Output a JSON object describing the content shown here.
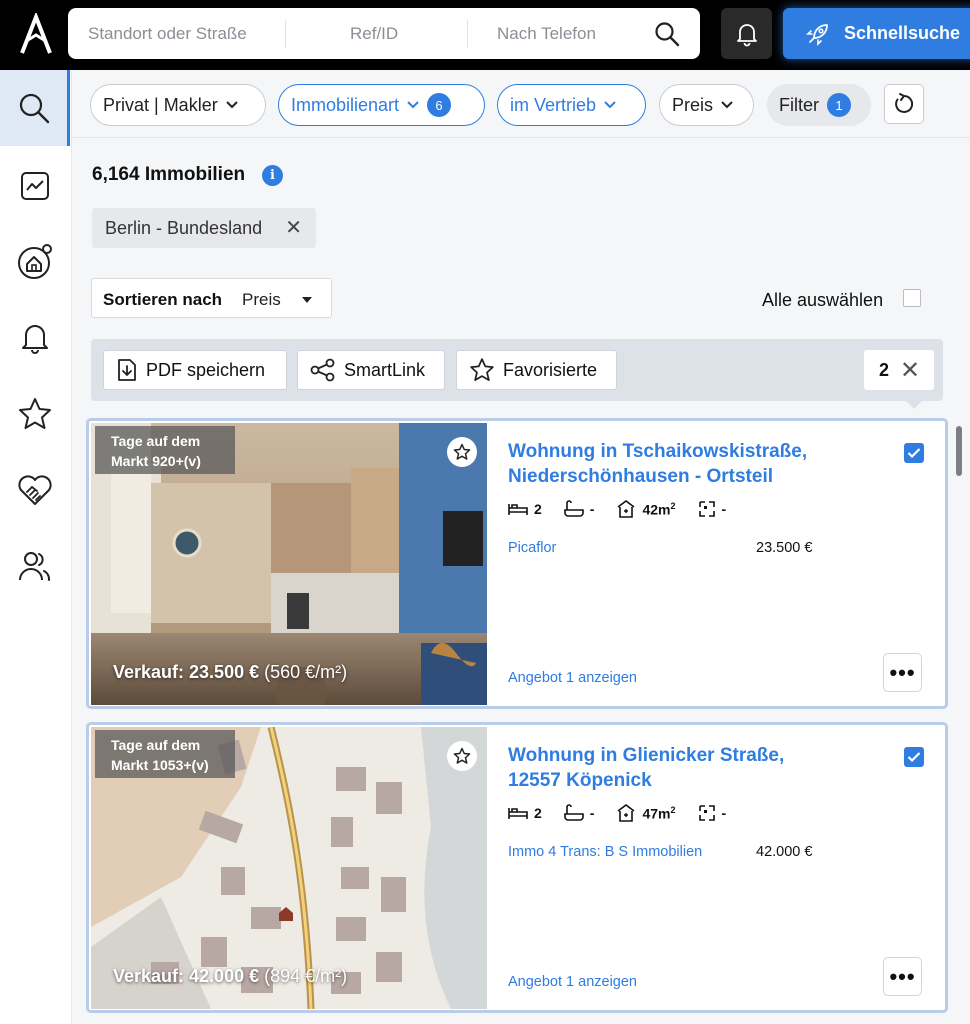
{
  "topbar": {
    "search_segments": [
      "Standort oder Straße",
      "Ref/ID",
      "Nach Telefon"
    ],
    "quick_search_label": "Schnellsuche"
  },
  "filters": {
    "owner_type": "Privat | Makler",
    "property_type": "Immobilienart",
    "property_type_count": "6",
    "status": "im Vertrieb",
    "price": "Preis",
    "filter": "Filter",
    "filter_count": "1"
  },
  "results": {
    "count_label": "6,164 Immobilien",
    "active_tag": "Berlin - Bundesland",
    "sort_label": "Sortieren nach",
    "sort_value": "Preis",
    "select_all_label": "Alle auswählen"
  },
  "actions": {
    "pdf": "PDF speichern",
    "smartlink": "SmartLink",
    "favorites": "Favorisierte",
    "selected_count": "2"
  },
  "listings": [
    {
      "days_line1": "Tage auf dem",
      "days_line2": "Markt 920+(v)",
      "price_overlay_bold": "Verkauf: 23.500 €",
      "price_overlay_rest": " (560 €/m²)",
      "title": "Wohnung in Tschaikowskistraße, Niederschönhausen - Ortsteil",
      "beds": "2",
      "baths": "-",
      "area_value": "42m",
      "area_sup": "2",
      "plot": "-",
      "agency": "Picaflor",
      "price": "23.500 €",
      "offer": "Angebot 1 anzeigen",
      "more": "•••"
    },
    {
      "days_line1": "Tage auf dem",
      "days_line2": "Markt 1053+(v)",
      "price_overlay_bold": "Verkauf: 42.000 €",
      "price_overlay_rest": " (894 €/m²)",
      "title": "Wohnung in Glienicker Straße, 12557 Köpenick",
      "beds": "2",
      "baths": "-",
      "area_value": "47m",
      "area_sup": "2",
      "plot": "-",
      "agency": "Immo 4 Trans: B S Immobilien",
      "price": "42.000 €",
      "offer": "Angebot 1 anzeigen",
      "more": "•••"
    }
  ],
  "colors": {
    "accent": "#2f7de1",
    "topbar": "#000000",
    "card_border": "#b9cdea"
  }
}
